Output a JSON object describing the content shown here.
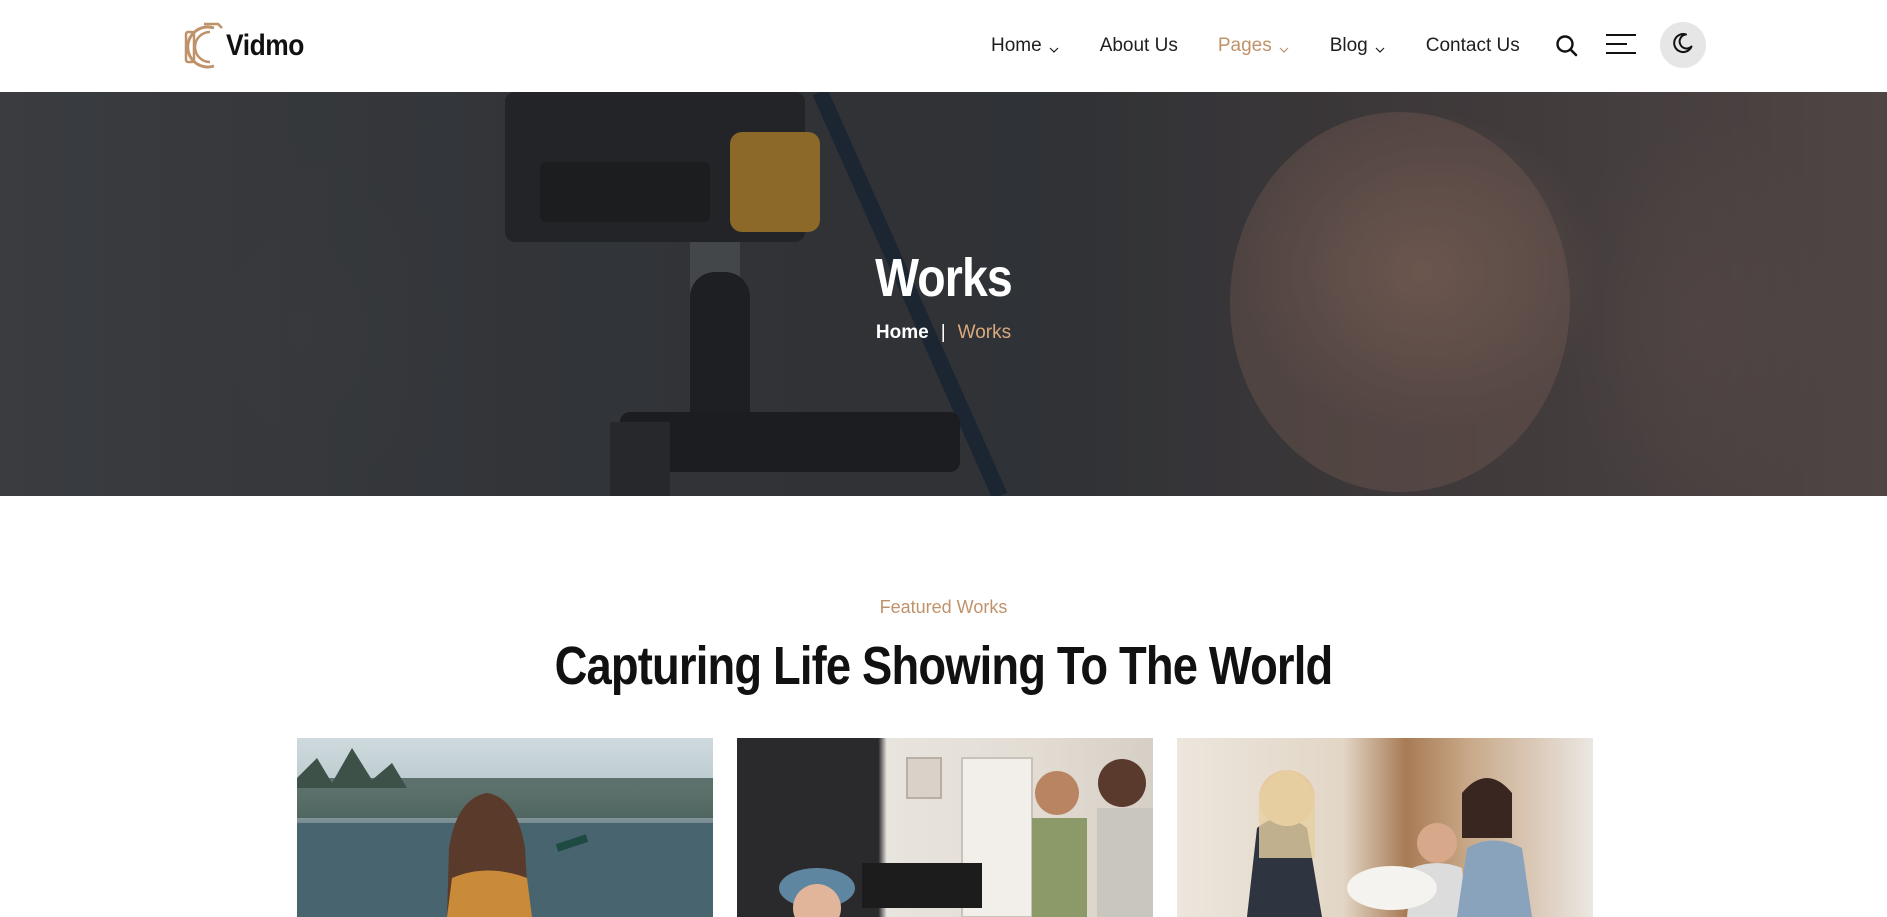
{
  "brand": {
    "name": "Vidmo",
    "accent": "#c0926a"
  },
  "nav": {
    "items": [
      {
        "label": "Home",
        "has_dropdown": true,
        "active": false
      },
      {
        "label": "About Us",
        "has_dropdown": false,
        "active": false
      },
      {
        "label": "Pages",
        "has_dropdown": true,
        "active": true
      },
      {
        "label": "Blog",
        "has_dropdown": true,
        "active": false
      },
      {
        "label": "Contact Us",
        "has_dropdown": false,
        "active": false
      }
    ],
    "icons": {
      "search": "search-icon",
      "menu": "hamburger-menu-icon",
      "theme": "moon-icon"
    }
  },
  "hero": {
    "title": "Works",
    "breadcrumb": {
      "home": "Home",
      "separator": "|",
      "current": "Works"
    }
  },
  "section": {
    "subtitle": "Featured Works",
    "title": "Capturing Life Showing To The World"
  }
}
